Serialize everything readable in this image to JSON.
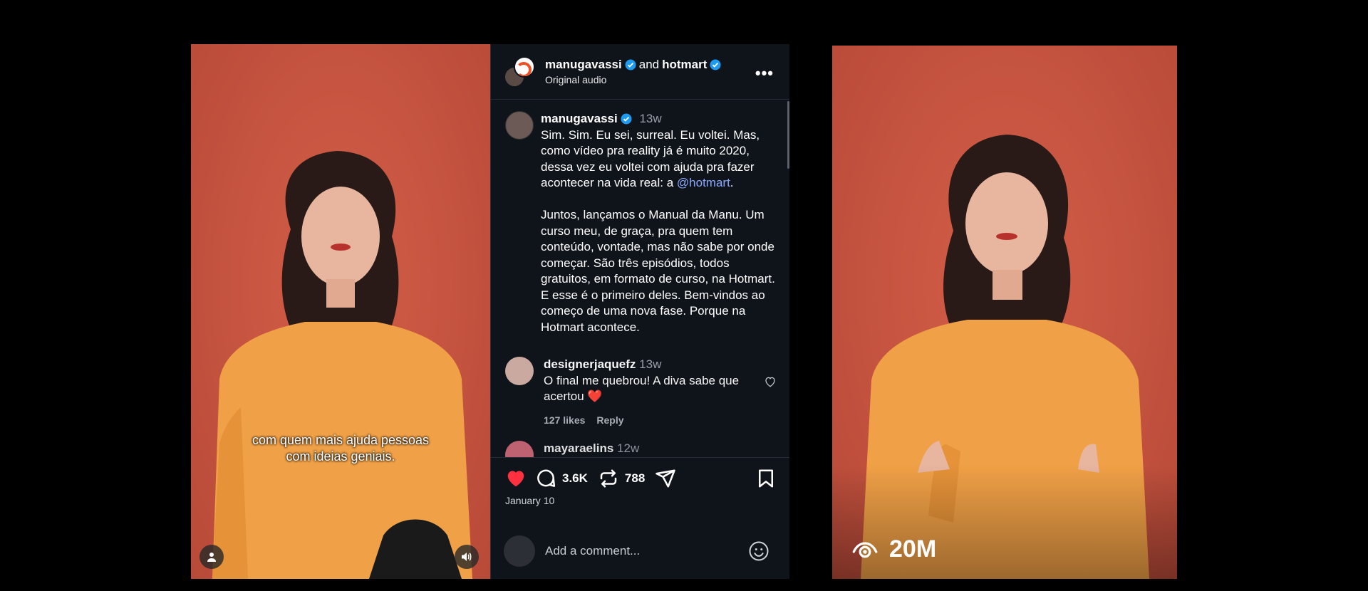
{
  "left_video": {
    "caption": "com quem mais ajuda pessoas\ncom ideias geniais."
  },
  "header": {
    "user1": "manugavassi",
    "and": "and",
    "user2": "hotmart",
    "audio": "Original audio",
    "more": "•••"
  },
  "post": {
    "author": "manugavassi",
    "time": "13w",
    "text_part1": "Sim. Sim. Eu sei, surreal. Eu voltei. Mas, como vídeo pra reality já é muito 2020, dessa vez eu voltei com ajuda pra fazer acontecer na vida real: a ",
    "mention": "@hotmart",
    "text_part2": ".\n\nJuntos, lançamos o Manual da Manu. Um curso meu, de graça, pra quem tem conteúdo, vontade, mas não sabe por onde começar. São três episódios, todos gratuitos, em formato de curso, na Hotmart. E esse é o primeiro deles. Bem-vindos ao começo de uma nova fase. Porque na Hotmart acontece."
  },
  "comments": [
    {
      "author": "designerjaquefz",
      "time": "13w",
      "text": "O final me quebrou! A diva sabe que acertou ❤️",
      "likes": "127 likes",
      "reply": "Reply"
    },
    {
      "author": "mayaraelins",
      "time": "12w"
    }
  ],
  "actions": {
    "comments_count": "3.6K",
    "reposts_count": "788",
    "date": "January 10",
    "liked_color": "#ff3040"
  },
  "comment_box": {
    "placeholder": "Add a comment..."
  },
  "right_video": {
    "views": "20M"
  }
}
